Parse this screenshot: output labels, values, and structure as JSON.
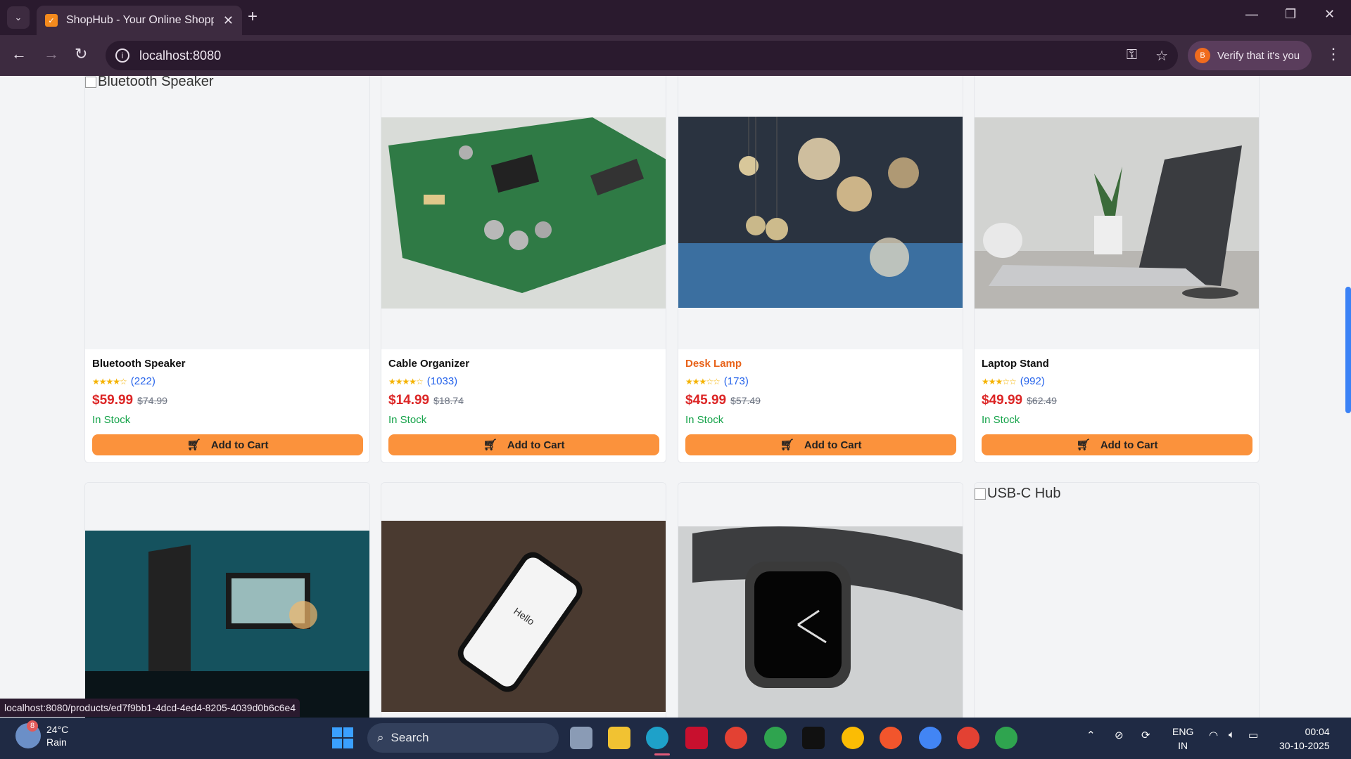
{
  "browser": {
    "tab_title": "ShopHub - Your Online Shopping",
    "url": "localhost:8080",
    "verify_label": "Verify that it's you",
    "profile_initial": "B",
    "status_url": "localhost:8080/products/ed7f9bb1-4dcd-4ed4-8205-4039d0b6c6e4"
  },
  "products": [
    {
      "name": "Bluetooth Speaker",
      "alt": "Bluetooth Speaker",
      "image": "broken",
      "stars": "★★★★☆",
      "rating": 4,
      "reviews": "(222)",
      "price": "$59.99",
      "old_price": "$74.99",
      "stock": "In Stock",
      "button": "Add to Cart",
      "highlight": false
    },
    {
      "name": "Cable Organizer",
      "alt": "Cable Organizer",
      "image": "circuit-board-photo",
      "stars": "★★★★☆",
      "rating": 4,
      "reviews": "(1033)",
      "price": "$14.99",
      "old_price": "$18.74",
      "stock": "In Stock",
      "button": "Add to Cart",
      "highlight": false
    },
    {
      "name": "Desk Lamp",
      "alt": "Desk Lamp",
      "image": "hanging-bulbs-photo",
      "stars": "★★★☆☆",
      "rating": 3,
      "reviews": "(173)",
      "price": "$45.99",
      "old_price": "$57.49",
      "stock": "In Stock",
      "button": "Add to Cart",
      "highlight": true
    },
    {
      "name": "Laptop Stand",
      "alt": "Laptop Stand",
      "image": "laptop-desk-photo",
      "stars": "★★★☆☆",
      "rating": 3,
      "reviews": "(992)",
      "price": "$49.99",
      "old_price": "$62.49",
      "stock": "In Stock",
      "button": "Add to Cart",
      "highlight": false
    }
  ],
  "row2": [
    {
      "image": "monitor-setup-photo"
    },
    {
      "image": "smartphone-photo",
      "screen_text": "Hello"
    },
    {
      "image": "smartwatch-photo"
    },
    {
      "image": "broken",
      "alt": "USB-C Hub"
    }
  ],
  "taskbar": {
    "temperature": "24°C",
    "weather": "Rain",
    "weather_badge": "8",
    "search_label": "Search",
    "lang_top": "ENG",
    "lang_bottom": "IN",
    "time": "00:04",
    "date": "30-10-2025"
  },
  "colors": {
    "accent": "#fb923c",
    "price": "#dc2626",
    "stock": "#16a34a",
    "rating_link": "#2563eb",
    "highlight_name": "#e8631a"
  }
}
